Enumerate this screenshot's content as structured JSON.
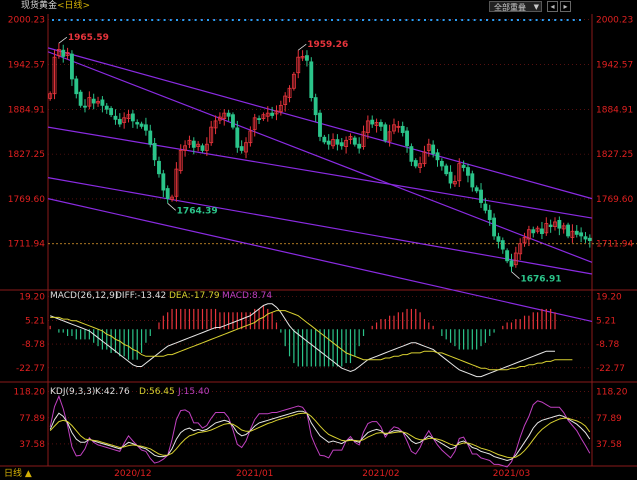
{
  "header": {
    "title": "现货黄金",
    "period": "<日线>",
    "period_selector": "全部重叠",
    "selector_arrow": "▼",
    "btn_prev": "◂",
    "btn_next": "▸"
  },
  "footer": {
    "period_tab": "日线 ▲"
  },
  "colors": {
    "up": "#e8343c",
    "down": "#2bc48a",
    "grid": "#8a1a1a",
    "axis_text": "#e02020",
    "trend": "#8a2be2",
    "price_line": "#e8a030",
    "dif": "#e6e6e6",
    "dea": "#d8d030",
    "k": "#e6e6e6",
    "d": "#d8d030",
    "j": "#c040c0",
    "dots": "#2a9df4"
  },
  "chart_data": [
    {
      "type": "candlestick",
      "name": "main",
      "y_ticks": [
        "2000.23",
        "1942.57",
        "1884.91",
        "1827.25",
        "1769.60",
        "1711.94"
      ],
      "ylim": [
        1655,
        2005
      ],
      "annotations": [
        "1965.59",
        "1959.26",
        "1764.39",
        "1676.91"
      ],
      "x_labels": [
        "2020/12",
        "2021/01",
        "2021/02",
        "2021/03"
      ],
      "close": [
        1905,
        1952,
        1962,
        1953,
        1958,
        1924,
        1905,
        1890,
        1888,
        1900,
        1893,
        1895,
        1890,
        1885,
        1878,
        1872,
        1866,
        1874,
        1878,
        1870,
        1866,
        1863,
        1858,
        1840,
        1820,
        1802,
        1781,
        1770,
        1772,
        1808,
        1832,
        1838,
        1845,
        1836,
        1840,
        1832,
        1840,
        1862,
        1870,
        1875,
        1880,
        1876,
        1862,
        1836,
        1832,
        1842,
        1857,
        1874,
        1872,
        1878,
        1880,
        1877,
        1883,
        1890,
        1902,
        1912,
        1930,
        1952,
        1953,
        1948,
        1900,
        1878,
        1850,
        1843,
        1840,
        1846,
        1840,
        1838,
        1845,
        1850,
        1840,
        1835,
        1856,
        1870,
        1866,
        1868,
        1863,
        1845,
        1856,
        1865,
        1863,
        1855,
        1838,
        1818,
        1812,
        1815,
        1830,
        1840,
        1828,
        1820,
        1812,
        1802,
        1790,
        1792,
        1815,
        1810,
        1800,
        1785,
        1780,
        1765,
        1755,
        1743,
        1722,
        1715,
        1705,
        1690,
        1683,
        1700,
        1712,
        1720,
        1730,
        1726,
        1732,
        1725,
        1738,
        1734,
        1740,
        1732,
        1735,
        1722,
        1728,
        1724,
        1722,
        1718,
        1716
      ],
      "current": "1711.94",
      "trend_lines": [
        [
          1964,
          1770
        ],
        [
          1770,
          1612
        ],
        [
          1959,
          1688
        ],
        [
          1862,
          1745
        ],
        [
          1797,
          1673
        ]
      ]
    },
    {
      "type": "bar",
      "name": "MACD",
      "label": "MACD(26,12,9)",
      "dif_label": "DIFF:-13.42",
      "dea_label": "DEA:-17.79",
      "macd_label": "MACD:8.74",
      "y_ticks": [
        "19.20",
        "5.21",
        "-8.78",
        "-22.77"
      ],
      "ylim": [
        -30,
        22
      ],
      "dif": [
        8,
        7,
        6,
        5,
        4,
        3,
        2,
        1,
        0,
        -1,
        -3,
        -5,
        -7,
        -9,
        -11,
        -13,
        -15,
        -17,
        -19,
        -21,
        -22,
        -22,
        -20,
        -18,
        -16,
        -14,
        -12,
        -10,
        -9,
        -8,
        -7,
        -6,
        -5,
        -4,
        -3,
        -2,
        -1,
        0,
        1,
        1,
        2,
        3,
        4,
        5,
        6,
        7,
        8,
        10,
        12,
        14,
        15,
        15,
        13,
        10,
        6,
        2,
        -1,
        -3,
        -5,
        -7,
        -9,
        -11,
        -13,
        -15,
        -17,
        -19,
        -21,
        -23,
        -24,
        -25,
        -24,
        -22,
        -20,
        -18,
        -17,
        -16,
        -15,
        -14,
        -13,
        -12,
        -11,
        -10,
        -9,
        -8,
        -8,
        -9,
        -10,
        -11,
        -12,
        -14,
        -16,
        -18,
        -20,
        -22,
        -24,
        -25,
        -26,
        -27,
        -28,
        -28,
        -27,
        -26,
        -25,
        -24,
        -23,
        -22,
        -21,
        -20,
        -19,
        -18,
        -17,
        -16,
        -15,
        -14,
        -13,
        -13,
        -13
      ],
      "dea": [
        7,
        7,
        7,
        6,
        6,
        5,
        5,
        4,
        3,
        2,
        1,
        0,
        -1,
        -3,
        -4,
        -6,
        -7,
        -9,
        -10,
        -12,
        -13,
        -15,
        -16,
        -16,
        -16,
        -16,
        -16,
        -15,
        -15,
        -14,
        -13,
        -12,
        -11,
        -10,
        -9,
        -8,
        -7,
        -6,
        -5,
        -4,
        -3,
        -2,
        -1,
        0,
        1,
        2,
        3,
        4,
        6,
        7,
        9,
        10,
        11,
        11,
        11,
        10,
        9,
        8,
        6,
        4,
        2,
        0,
        -2,
        -4,
        -6,
        -8,
        -10,
        -12,
        -14,
        -15,
        -16,
        -17,
        -18,
        -18,
        -18,
        -18,
        -18,
        -17,
        -17,
        -16,
        -16,
        -15,
        -15,
        -14,
        -14,
        -14,
        -13,
        -13,
        -13,
        -14,
        -14,
        -15,
        -16,
        -17,
        -18,
        -19,
        -20,
        -21,
        -22,
        -23,
        -23,
        -24,
        -24,
        -24,
        -24,
        -24,
        -23,
        -23,
        -22,
        -22,
        -21,
        -21,
        -20,
        -20,
        -19,
        -19,
        -18,
        -18,
        -18,
        -18,
        -18
      ]
    },
    {
      "type": "line",
      "name": "KDJ",
      "label": "KDJ(9,3,3)",
      "k_label": "K:42.76",
      "d_label": "D:56.45",
      "j_label": "J:15.40",
      "y_ticks": [
        "118.20",
        "77.89",
        "37.58"
      ],
      "ylim": [
        5,
        130
      ],
      "k": [
        60,
        75,
        85,
        80,
        70,
        55,
        45,
        40,
        40,
        45,
        42,
        40,
        38,
        36,
        34,
        32,
        30,
        35,
        40,
        38,
        35,
        32,
        30,
        25,
        20,
        18,
        18,
        20,
        30,
        45,
        55,
        60,
        62,
        58,
        60,
        58,
        60,
        65,
        70,
        72,
        74,
        72,
        65,
        55,
        50,
        52,
        58,
        65,
        70,
        72,
        74,
        76,
        78,
        80,
        82,
        84,
        86,
        88,
        88,
        85,
        70,
        60,
        50,
        45,
        40,
        42,
        40,
        38,
        42,
        45,
        42,
        40,
        48,
        55,
        58,
        60,
        58,
        52,
        55,
        58,
        58,
        56,
        50,
        42,
        38,
        40,
        45,
        50,
        46,
        42,
        38,
        34,
        30,
        32,
        40,
        42,
        38,
        32,
        30,
        26,
        24,
        22,
        18,
        16,
        14,
        12,
        14,
        20,
        30,
        40,
        50,
        62,
        70,
        74,
        76,
        78,
        80,
        82,
        80,
        76,
        72,
        68,
        62,
        55,
        45
      ],
      "d": [
        58,
        65,
        72,
        74,
        72,
        66,
        58,
        50,
        45,
        44,
        43,
        42,
        40,
        38,
        36,
        34,
        32,
        33,
        35,
        36,
        35,
        34,
        32,
        30,
        26,
        22,
        20,
        20,
        23,
        30,
        38,
        45,
        50,
        52,
        55,
        56,
        57,
        59,
        62,
        65,
        68,
        69,
        68,
        64,
        59,
        57,
        57,
        60,
        63,
        66,
        69,
        71,
        74,
        76,
        78,
        80,
        82,
        84,
        85,
        85,
        80,
        73,
        65,
        58,
        52,
        49,
        46,
        43,
        42,
        43,
        43,
        42,
        44,
        48,
        51,
        54,
        55,
        54,
        54,
        55,
        56,
        56,
        54,
        50,
        46,
        44,
        44,
        46,
        46,
        45,
        43,
        40,
        37,
        35,
        37,
        39,
        39,
        37,
        34,
        31,
        29,
        27,
        24,
        21,
        19,
        17,
        16,
        17,
        21,
        27,
        35,
        44,
        53,
        60,
        65,
        70,
        73,
        76,
        77,
        77,
        75,
        73,
        70,
        65,
        56
      ],
      "j": [
        64,
        95,
        111,
        92,
        66,
        33,
        19,
        20,
        30,
        47,
        40,
        36,
        34,
        32,
        30,
        28,
        26,
        39,
        50,
        42,
        35,
        28,
        26,
        15,
        8,
        10,
        14,
        20,
        44,
        75,
        89,
        90,
        86,
        70,
        70,
        62,
        66,
        77,
        86,
        86,
        86,
        78,
        59,
        37,
        32,
        42,
        60,
        75,
        84,
        84,
        84,
        86,
        86,
        88,
        90,
        92,
        94,
        96,
        94,
        85,
        50,
        34,
        20,
        19,
        16,
        28,
        28,
        28,
        42,
        49,
        40,
        36,
        56,
        69,
        72,
        72,
        64,
        48,
        57,
        64,
        62,
        56,
        42,
        26,
        22,
        32,
        47,
        58,
        46,
        36,
        28,
        22,
        16,
        26,
        46,
        48,
        36,
        22,
        22,
        16,
        14,
        12,
        6,
        6,
        4,
        2,
        10,
        26,
        48,
        66,
        80,
        98,
        104,
        102,
        98,
        94,
        94,
        94,
        86,
        74,
        66,
        58,
        46,
        35,
        23
      ]
    }
  ]
}
